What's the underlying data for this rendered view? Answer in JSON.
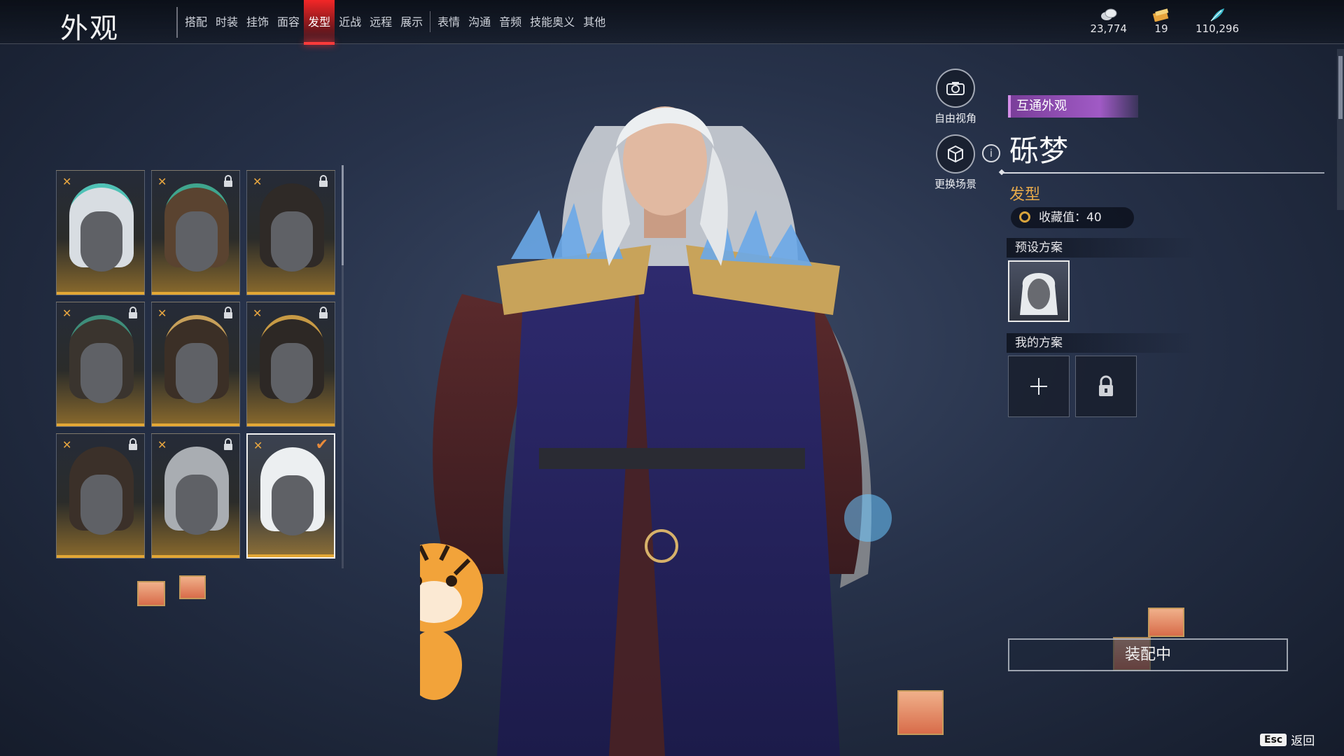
{
  "header": {
    "title": "外观",
    "tabs": [
      {
        "label": "搭配",
        "active": false
      },
      {
        "label": "时装",
        "active": false
      },
      {
        "label": "挂饰",
        "active": false
      },
      {
        "label": "面容",
        "active": false
      },
      {
        "label": "发型",
        "active": true
      },
      {
        "label": "近战",
        "active": false
      },
      {
        "label": "远程",
        "active": false
      },
      {
        "label": "展示",
        "active": false
      },
      {
        "label": "表情",
        "active": false
      },
      {
        "label": "沟通",
        "active": false
      },
      {
        "label": "音频",
        "active": false
      },
      {
        "label": "技能奥义",
        "active": false
      },
      {
        "label": "其他",
        "active": false
      }
    ],
    "currencies": [
      {
        "icon": "coin-stack-icon",
        "value": "23,774"
      },
      {
        "icon": "ticket-icon",
        "value": "19"
      },
      {
        "icon": "feather-icon",
        "value": "110,296"
      }
    ]
  },
  "hairstyles": [
    {
      "hair_color": "#d8dde2",
      "accent": "#4fc2b6",
      "locked": false,
      "selected": false
    },
    {
      "hair_color": "#5a4330",
      "accent": "#3fa58e",
      "locked": true,
      "selected": false
    },
    {
      "hair_color": "#2f2a27",
      "accent": "",
      "locked": true,
      "selected": false
    },
    {
      "hair_color": "#3a342e",
      "accent": "#3e8d7a",
      "locked": true,
      "selected": false
    },
    {
      "hair_color": "#3b2f26",
      "accent": "#c7a05a",
      "locked": true,
      "selected": false
    },
    {
      "hair_color": "#2d2825",
      "accent": "#c79a45",
      "locked": true,
      "selected": false
    },
    {
      "hair_color": "#3b3029",
      "accent": "",
      "locked": true,
      "selected": false
    },
    {
      "hair_color": "#a9adb2",
      "accent": "",
      "locked": true,
      "selected": false
    },
    {
      "hair_color": "#eceff1",
      "accent": "",
      "locked": false,
      "selected": true
    }
  ],
  "side_buttons": {
    "free_view": "自由视角",
    "change_scene": "更换场景"
  },
  "detail": {
    "tag": "互通外观",
    "name": "砾梦",
    "category": "发型",
    "collect_value": "收藏值：40",
    "preset_header": "预设方案",
    "my_header": "我的方案",
    "equip_label": "装配中"
  },
  "footer": {
    "esc_key": "Esc",
    "back_label": "返回"
  },
  "colors": {
    "accent_red": "#ff3b3b",
    "gold": "#e3a735",
    "purple_tag": "#a05ac5"
  }
}
